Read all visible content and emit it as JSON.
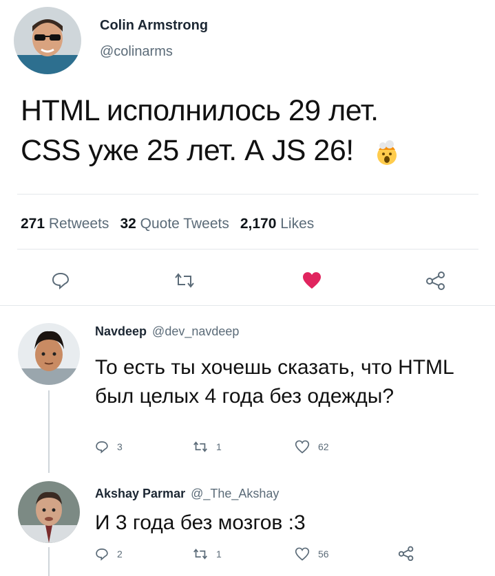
{
  "tweet": {
    "author_name": "Colin Armstrong",
    "author_handle": "@colinarms",
    "text_line1": "HTML исполнилось 29 лет.",
    "text_line2": "CSS уже 25 лет. А JS 26!",
    "emoji_icon": "exploding-head-emoji",
    "stats": {
      "retweets_count": "271",
      "retweets_label": "Retweets",
      "quotes_count": "32",
      "quotes_label": "Quote Tweets",
      "likes_count": "2,170",
      "likes_label": "Likes"
    },
    "like_color": "#e0245e"
  },
  "replies": [
    {
      "author_name": "Navdeep",
      "author_handle": "@dev_navdeep",
      "text_line1": "То есть ты хочешь сказать, что HTML",
      "text_line2": "был целых 4 года без одежды?",
      "reply_count": "3",
      "retweet_count": "1",
      "like_count": "62"
    },
    {
      "author_name": "Akshay Parmar",
      "author_handle": "@_The_Akshay",
      "text_line1": "И 3 года без мозгов :3",
      "reply_count": "2",
      "retweet_count": "1",
      "like_count": "56"
    }
  ]
}
